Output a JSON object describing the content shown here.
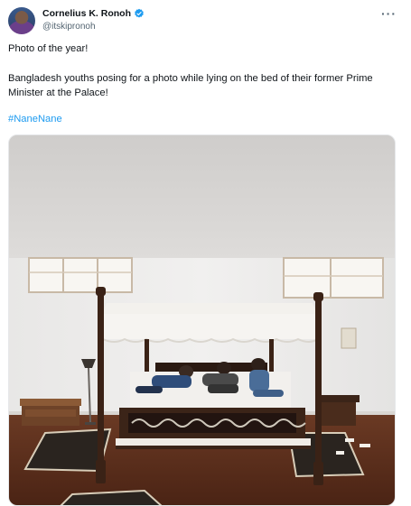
{
  "author": {
    "display_name": "Cornelius K. Ronoh",
    "handle": "@itskipronoh",
    "verified_icon": "verified-badge-icon",
    "avatar_icon": "profile-avatar"
  },
  "more_icon": "more-options-icon",
  "post": {
    "line1": "Photo of the year!",
    "line2": "Bangladesh youths posing for a photo while lying on the bed of their former Prime Minister at the Palace!",
    "hashtag": "#NaneNane"
  },
  "media": {
    "description_icon": "photo-image",
    "colors": {
      "ceiling": "#d6d4d2",
      "wall": "#ecebea",
      "floor": "#5c2e1c",
      "canopy": "#f4f2ef",
      "wood": "#3d2417"
    }
  },
  "colors": {
    "accent": "#1d9bf0",
    "text": "#0f1419",
    "secondary": "#536471"
  }
}
